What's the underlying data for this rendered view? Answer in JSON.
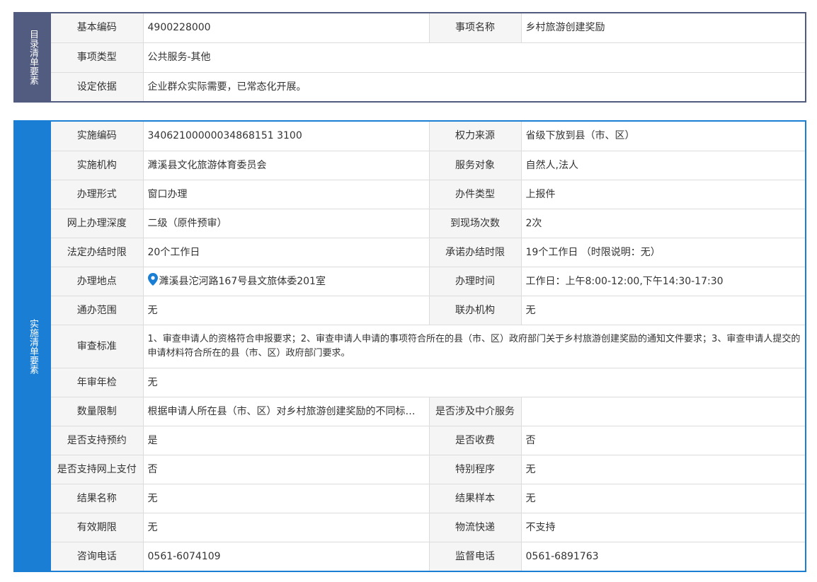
{
  "catalog": {
    "side_label": "目录清单要素",
    "basic_code_label": "基本编码",
    "basic_code": "4900228000",
    "item_name_label": "事项名称",
    "item_name": "乡村旅游创建奖励",
    "item_type_label": "事项类型",
    "item_type": "公共服务-其他",
    "basis_label": "设定依据",
    "basis": "企业群众实际需要，已常态化开展。"
  },
  "impl": {
    "side_label": "实施清单要素",
    "impl_code_label": "实施编码",
    "impl_code": "34062100000034868151 3100",
    "power_source_label": "权力来源",
    "power_source": "省级下放到县（市、区）",
    "org_label": "实施机构",
    "org": "濉溪县文化旅游体育委员会",
    "service_target_label": "服务对象",
    "service_target": "自然人,法人",
    "form_label": "办理形式",
    "form": "窗口办理",
    "case_type_label": "办件类型",
    "case_type": "上报件",
    "online_depth_label": "网上办理深度",
    "online_depth": "二级（原件预审）",
    "visits_label": "到现场次数",
    "visits": "2次",
    "legal_limit_label": "法定办结时限",
    "legal_limit": "20个工作日",
    "promise_limit_label": "承诺办结时限",
    "promise_limit": "19个工作日 （时限说明：无）",
    "location_label": "办理地点",
    "location": "濉溪县沱河路167号县文旅体委201室",
    "hours_label": "办理时间",
    "hours": "工作日：上午8:00-12:00,下午14:30-17:30",
    "scope_label": "通办范围",
    "scope": "无",
    "joint_org_label": "联办机构",
    "joint_org": "无",
    "review_label": "审查标准",
    "review": "1、审查申请人的资格符合申报要求；2、审查申请人申请的事项符合所在的县（市、区）政府部门关于乡村旅游创建奖励的通知文件要求；3、审查申请人提交的申请材料符合所在的县（市、区）政府部门要求。",
    "annual_label": "年审年检",
    "annual": "无",
    "quantity_label": "数量限制",
    "quantity": "根据申请人所在县（市、区）对乡村旅游创建奖励的不同标准...",
    "intermediary_label": "是否涉及中介服务",
    "intermediary": "",
    "appointment_label": "是否支持预约",
    "appointment": "是",
    "charge_label": "是否收费",
    "charge": "否",
    "online_pay_label": "是否支持网上支付",
    "online_pay": "否",
    "special_label": "特别程序",
    "special": "无",
    "result_name_label": "结果名称",
    "result_name": "无",
    "result_sample_label": "结果样本",
    "result_sample": "无",
    "validity_label": "有效期限",
    "validity": "无",
    "express_label": "物流快递",
    "express": "不支持",
    "consult_phone_label": "咨询电话",
    "consult_phone": "0561-6074109",
    "supervise_phone_label": "监督电话",
    "supervise_phone": "0561-6891763"
  },
  "colors": {
    "catalog_side": "#525c80",
    "impl_side": "#1a7ed4",
    "pin": "#1a7ed4"
  },
  "icons": {
    "location": "map-pin-icon"
  }
}
